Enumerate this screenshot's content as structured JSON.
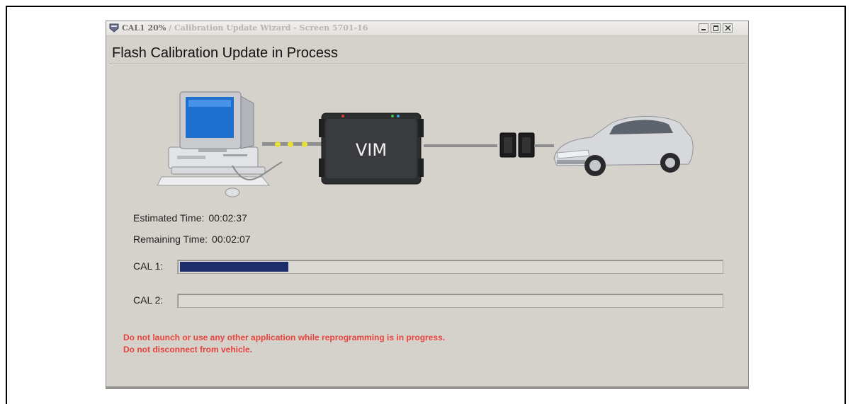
{
  "window": {
    "title_prefix": "CAL1 20%",
    "title_rest": " / Calibration Update Wizard - Screen 5701-16"
  },
  "heading": "Flash Calibration Update in Process",
  "diagram": {
    "computer_icon": "desktop-computer-icon",
    "device_label": "VIM",
    "connector_icon": "dlc-connector-icon",
    "vehicle_icon": "car-icon"
  },
  "times": {
    "estimated_label": "Estimated Time:",
    "estimated_value": "00:02:37",
    "remaining_label": "Remaining Time:",
    "remaining_value": "00:02:07"
  },
  "progress": [
    {
      "label": "CAL 1:",
      "value": 0.2
    },
    {
      "label": "CAL 2:",
      "value": 0
    }
  ],
  "warnings": [
    "Do not launch or use any other application while reprogramming is in progress.",
    "Do not disconnect from vehicle."
  ],
  "colors": {
    "progress_fill": "#1c2d6b",
    "warning_text": "#e8433c",
    "window_bg": "#d5d2cc"
  }
}
